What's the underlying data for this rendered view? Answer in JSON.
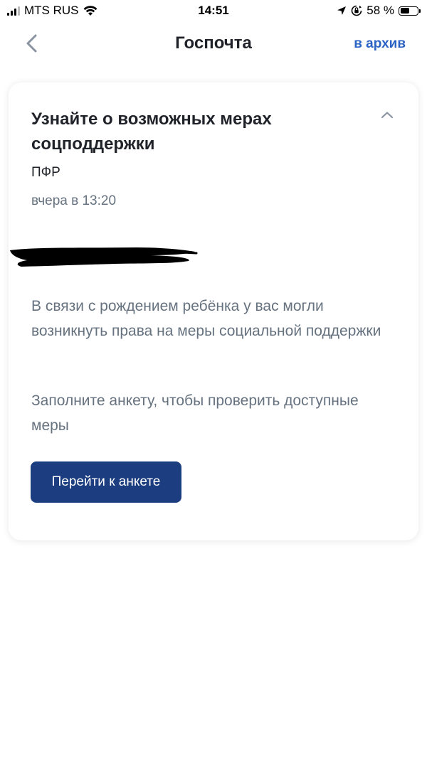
{
  "status_bar": {
    "carrier": "MTS RUS",
    "time": "14:51",
    "battery_percent": "58 %",
    "battery_level": 0.58,
    "icons": [
      "signal-icon",
      "wifi-icon",
      "location-arrow-icon",
      "rotation-lock-icon",
      "battery-icon"
    ]
  },
  "nav": {
    "title": "Госпочта",
    "archive_label": "в архив",
    "back_icon": "chevron-left-icon"
  },
  "message": {
    "title": "Узнайте о возможных мерах соцподдержки",
    "sender": "ПФР",
    "date": "вчера в 13:20",
    "paragraphs": [
      "В связи с рождением ребёнка у вас могли возникнуть права на меры социальной поддержки",
      "Заполните анкету, чтобы проверить доступные меры"
    ],
    "button_label": "Перейти к анкете",
    "collapse_icon": "chevron-up-icon"
  },
  "colors": {
    "accent_link": "#2b62c4",
    "button_bg": "#1c3d7f",
    "secondary_text": "#66727f",
    "primary_text": "#1f2329"
  }
}
